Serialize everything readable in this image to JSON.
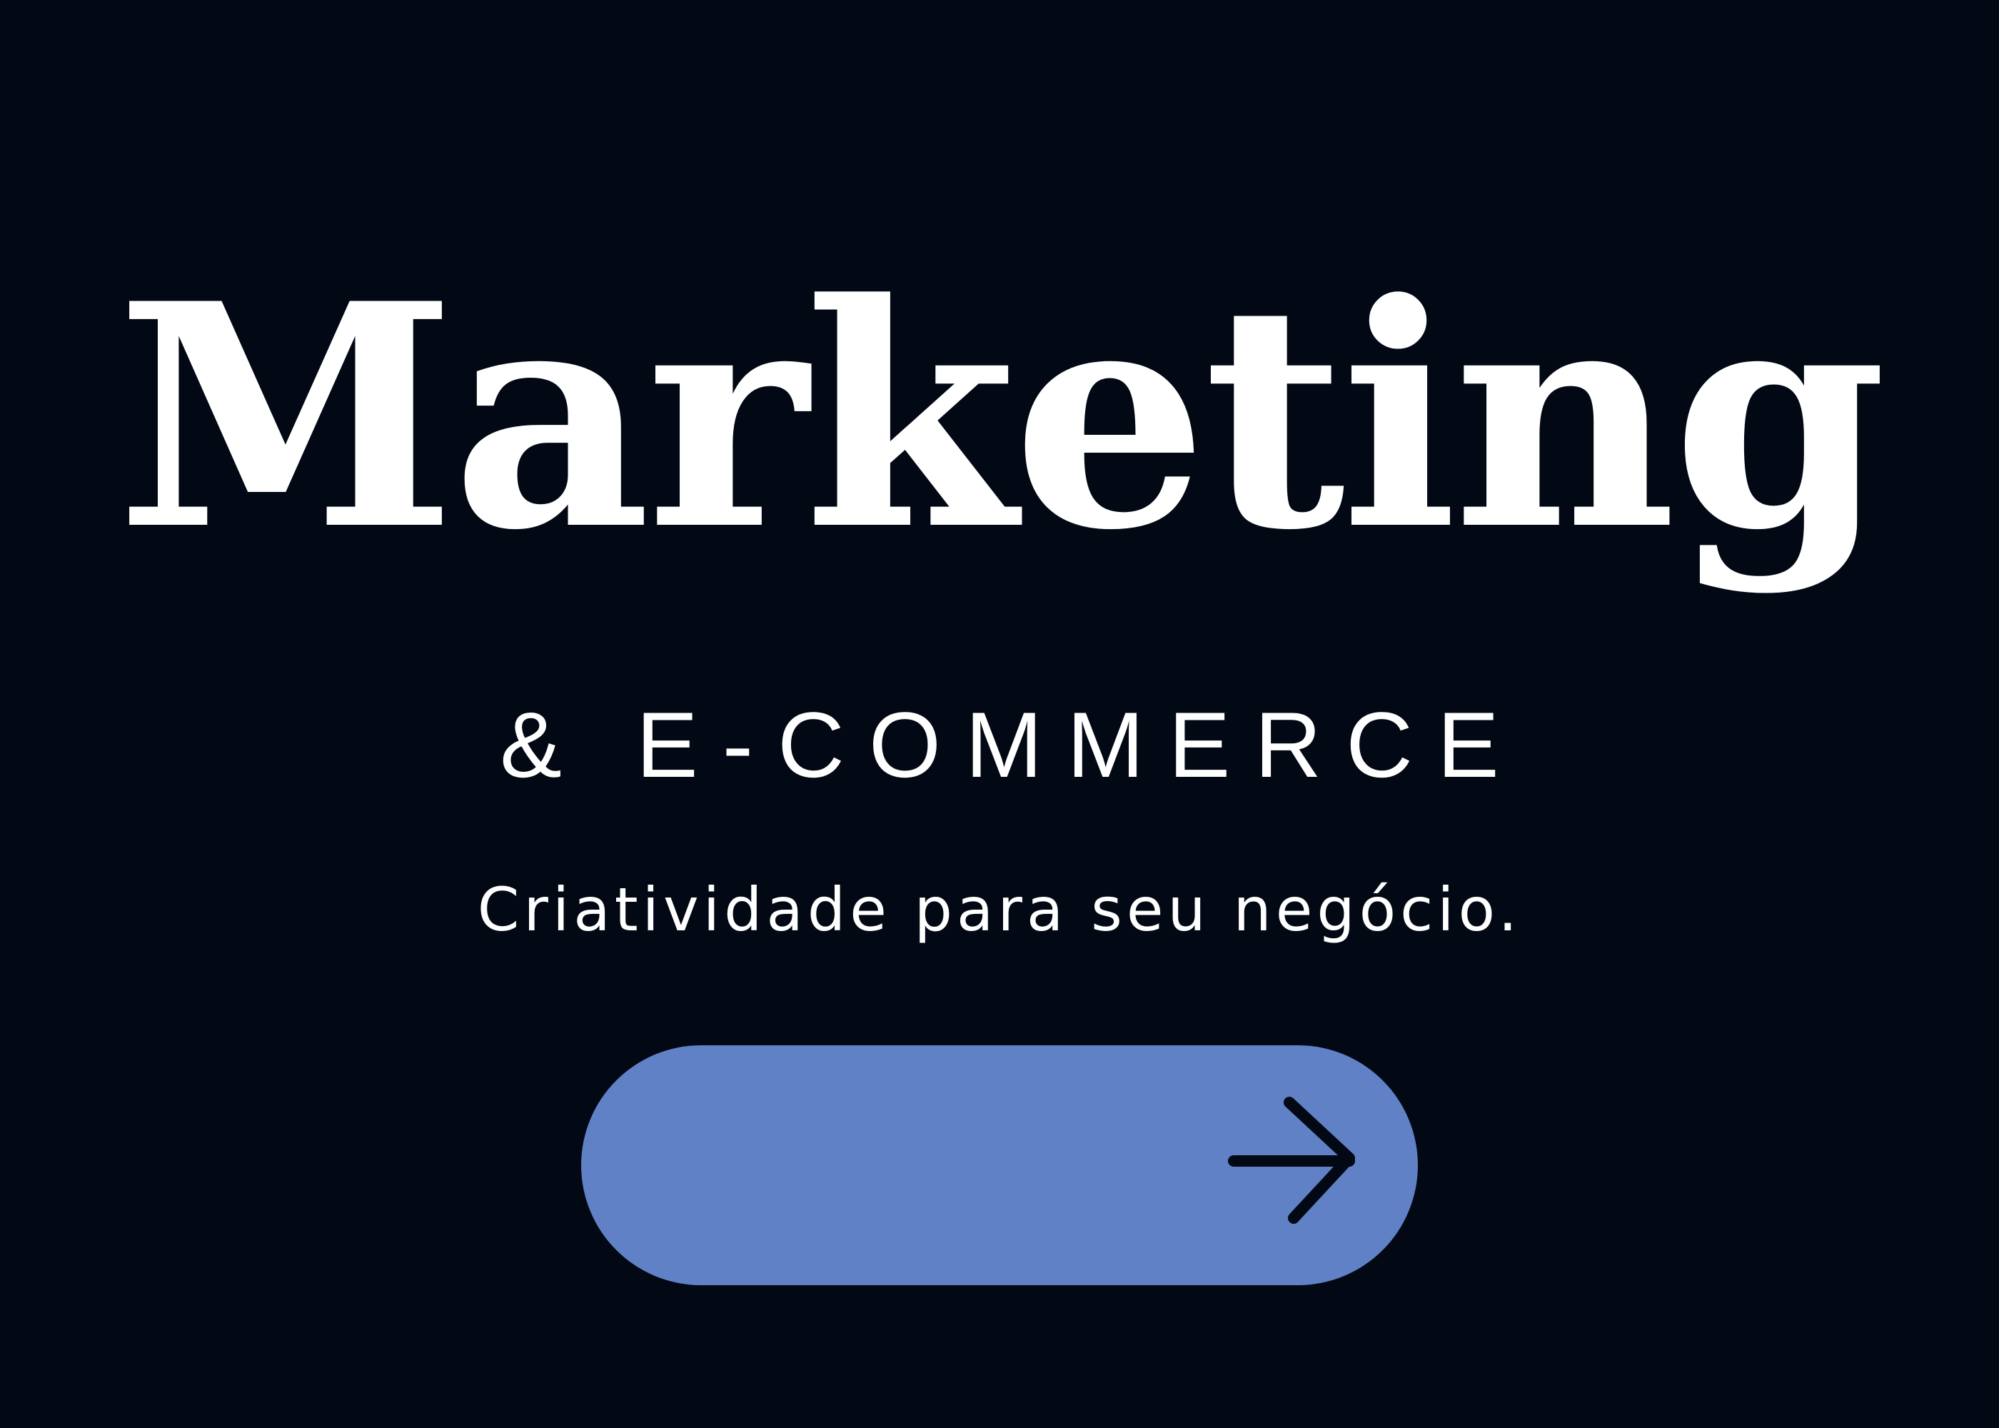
{
  "hero": {
    "title": "Marketing",
    "subtitle": "& E-COMMERCE",
    "tagline": "Criatividade para seu negócio."
  },
  "cta": {
    "icon": "arrow-right-icon",
    "color": "#6181c6"
  },
  "colors": {
    "background": "#020914",
    "text": "#ffffff",
    "icon": "#020914"
  }
}
